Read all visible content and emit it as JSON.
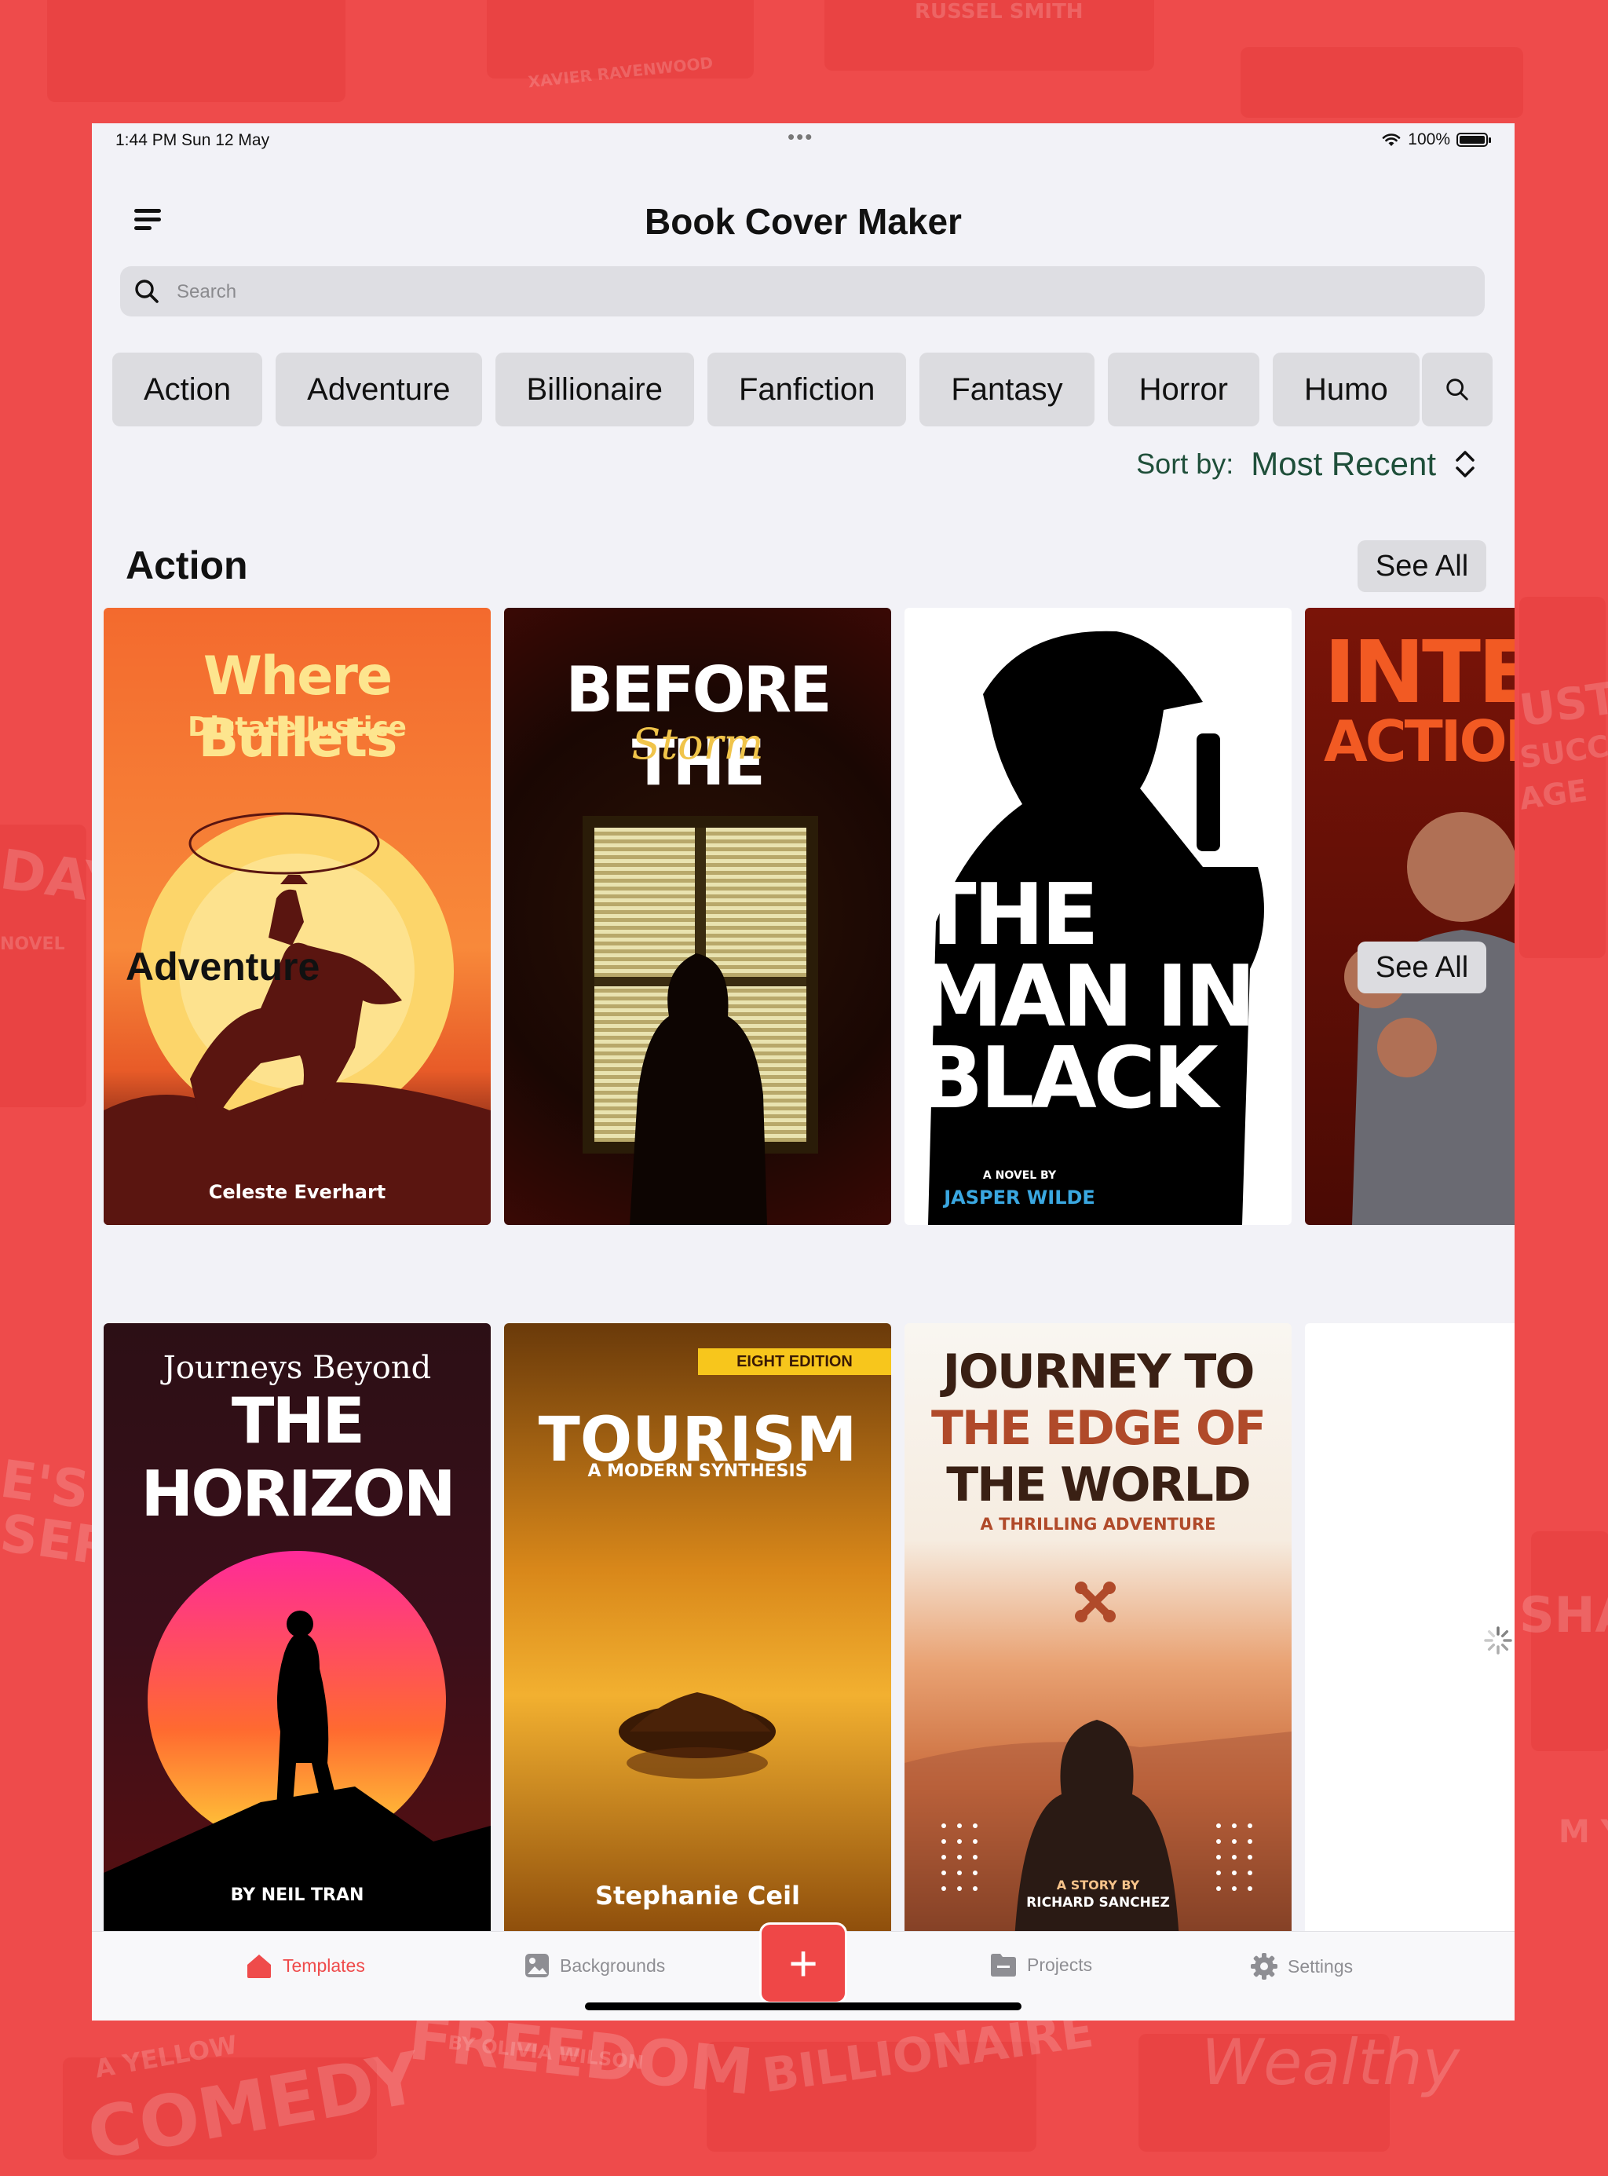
{
  "app": {
    "title": "Book Cover Maker"
  },
  "status_bar": {
    "time": "1:44 PM   Sun 12 May",
    "dots": "•••",
    "battery": "100%"
  },
  "search": {
    "placeholder": "Search"
  },
  "categories": [
    "Action",
    "Adventure",
    "Billionaire",
    "Fanfiction",
    "Fantasy",
    "Horror",
    "Humo"
  ],
  "sort": {
    "label": "Sort by:",
    "value": "Most Recent"
  },
  "sections": [
    {
      "title": "Action",
      "see_all": "See All",
      "covers": [
        {
          "title": "Where Bullets",
          "subtitle": "Dictate Justice",
          "author": "Celeste Everhart"
        },
        {
          "title": "BEFORE THE",
          "script": "Storm"
        },
        {
          "line1": "THE",
          "line2": "MAN IN",
          "line3": "BLACK",
          "tagline": "A NOVEL BY",
          "author": "JASPER WILDE"
        },
        {
          "line1": "INTEN",
          "line2": "ACTION"
        }
      ]
    },
    {
      "title": "Adventure",
      "see_all": "See All",
      "covers": [
        {
          "kicker": "Journeys Beyond",
          "title": "THE HORIZON",
          "author": "BY NEIL TRAN"
        },
        {
          "edition": "EIGHT EDITION",
          "title": "TOURISM",
          "subtitle": "A MODERN SYNTHESIS",
          "author": "Stephanie Ceil"
        },
        {
          "line1": "JOURNEY TO",
          "line2": "THE EDGE OF",
          "line3": "THE WORLD",
          "subtitle": "A THRILLING ADVENTURE",
          "tagline": "A STORY BY",
          "author": "RICHARD SANCHEZ"
        }
      ]
    }
  ],
  "background_text": [
    "XAVIER RAVENWOOD",
    "RUSSEL SMITH",
    "DAYS",
    "NOVEL",
    "E'S ET",
    "SEREN",
    "USTLE",
    "SUCCESS",
    "AGE",
    "COMEDY",
    "A YELLOW",
    "FREEDOM",
    "BY OLIVIA WILSON",
    "BILLIONAIRE",
    "Wealthy",
    "SHADO",
    "M Y"
  ],
  "tabs": [
    {
      "label": "Templates",
      "icon": "house-icon",
      "active": true
    },
    {
      "label": "Backgrounds",
      "icon": "image-icon",
      "active": false
    },
    {
      "label": "Projects",
      "icon": "folder-icon",
      "active": false
    },
    {
      "label": "Settings",
      "icon": "gear-icon",
      "active": false
    }
  ],
  "add_button": {
    "label": "+"
  },
  "colors": {
    "accent": "#ef4b4b",
    "sort": "#1f4f3a",
    "background": "#ee4b4b",
    "surface": "#f2f2f7"
  }
}
